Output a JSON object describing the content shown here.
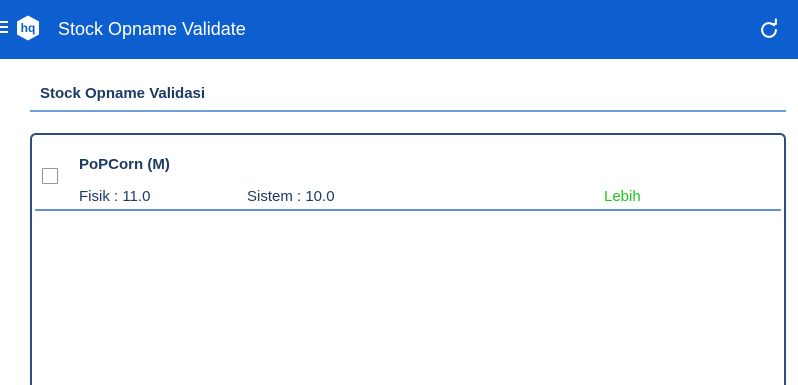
{
  "app_bar": {
    "title": "Stock Opname Validate",
    "logo_text": "hq",
    "background_color": "#0d5fd0",
    "menu_icon": "menu-icon",
    "refresh_icon": "refresh-icon"
  },
  "section": {
    "title": "Stock Opname Validasi"
  },
  "items": [
    {
      "name": "PoPCorn (M)",
      "fisik": "Fisik : 11.0",
      "sistem": "Sistem : 10.0",
      "status": "Lebih",
      "status_color": "#22c31c",
      "checked": false
    }
  ]
}
